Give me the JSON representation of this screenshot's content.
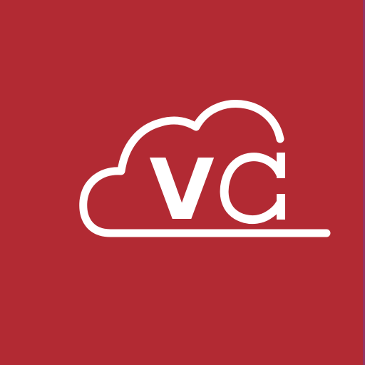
{
  "logo": {
    "text_v": "V",
    "text_c": "C"
  },
  "colors": {
    "background": "#B22A33",
    "foreground": "#FFFFFF",
    "edge_tint": "#7B3A8C"
  }
}
